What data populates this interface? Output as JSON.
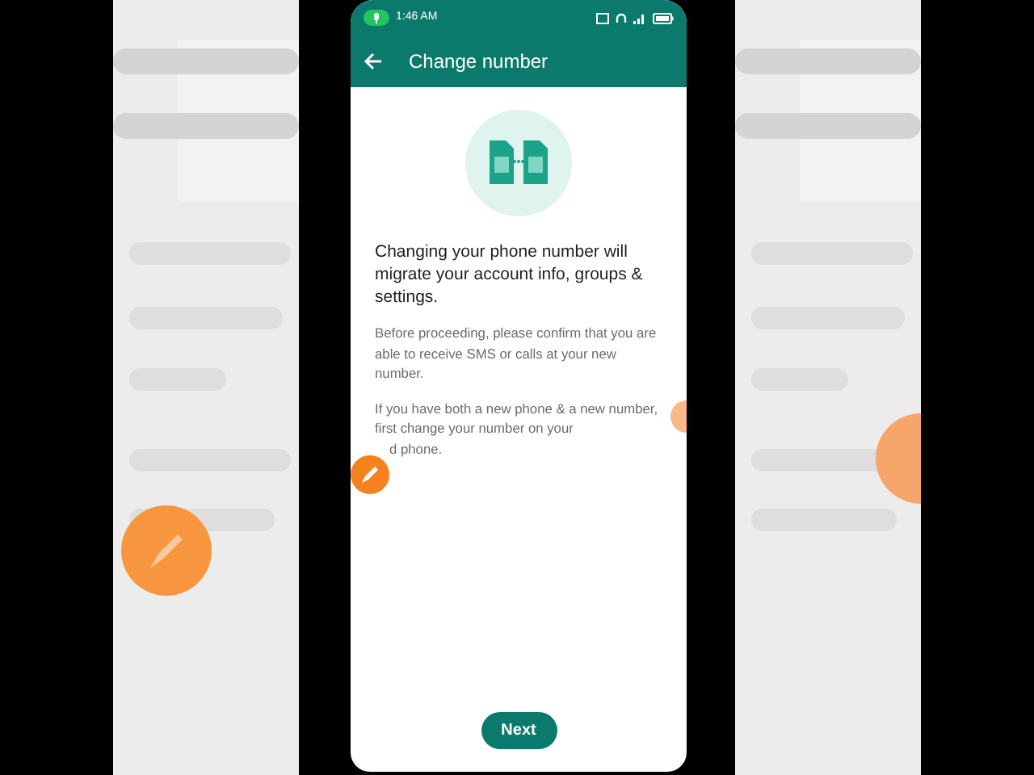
{
  "status_bar": {
    "time": "1:46 AM"
  },
  "app_bar": {
    "title": "Change number"
  },
  "heading": "Changing your phone number will migrate your account info, groups & settings.",
  "paragraphs": [
    "Before proceeding, please confirm that you are able to receive SMS or calls at your new number.",
    "If you have both a new phone & a new number, first change your number on your"
  ],
  "covered_tail": "d phone.",
  "next_button": {
    "label": "Next"
  }
}
